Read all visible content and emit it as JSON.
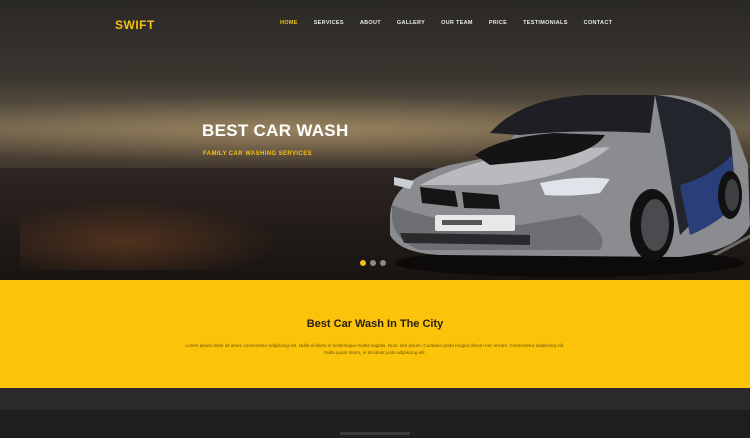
{
  "brand": {
    "logo": "SWIFT",
    "accent": "#f2c014",
    "band_color": "#fcc30b"
  },
  "nav": {
    "items": [
      {
        "label": "HOME",
        "active": true
      },
      {
        "label": "SERVICES",
        "active": false
      },
      {
        "label": "ABOUT",
        "active": false
      },
      {
        "label": "GALLERY",
        "active": false
      },
      {
        "label": "OUR TEAM",
        "active": false
      },
      {
        "label": "PRICE",
        "active": false
      },
      {
        "label": "TESTIMONIALS",
        "active": false
      },
      {
        "label": "CONTACT",
        "active": false
      }
    ]
  },
  "hero": {
    "title": "BEST CAR WASH",
    "subtitle": "FAMILY CAR WASHING SERVICES",
    "slides": 3,
    "active_slide": 1
  },
  "intro": {
    "title": "Best Car Wash In The City",
    "text": "Lorem ipsum dolor sit amet, consectetur adipiscing elit. Nulla at libero in scelerisque mattis sagittis. Nunc sed ipsum. Curabitur porta feugiat dictum nec ornare. Consectetur adipiscing elit. Nulla quam lorem, in tincidunt justo adipiscing elit."
  }
}
